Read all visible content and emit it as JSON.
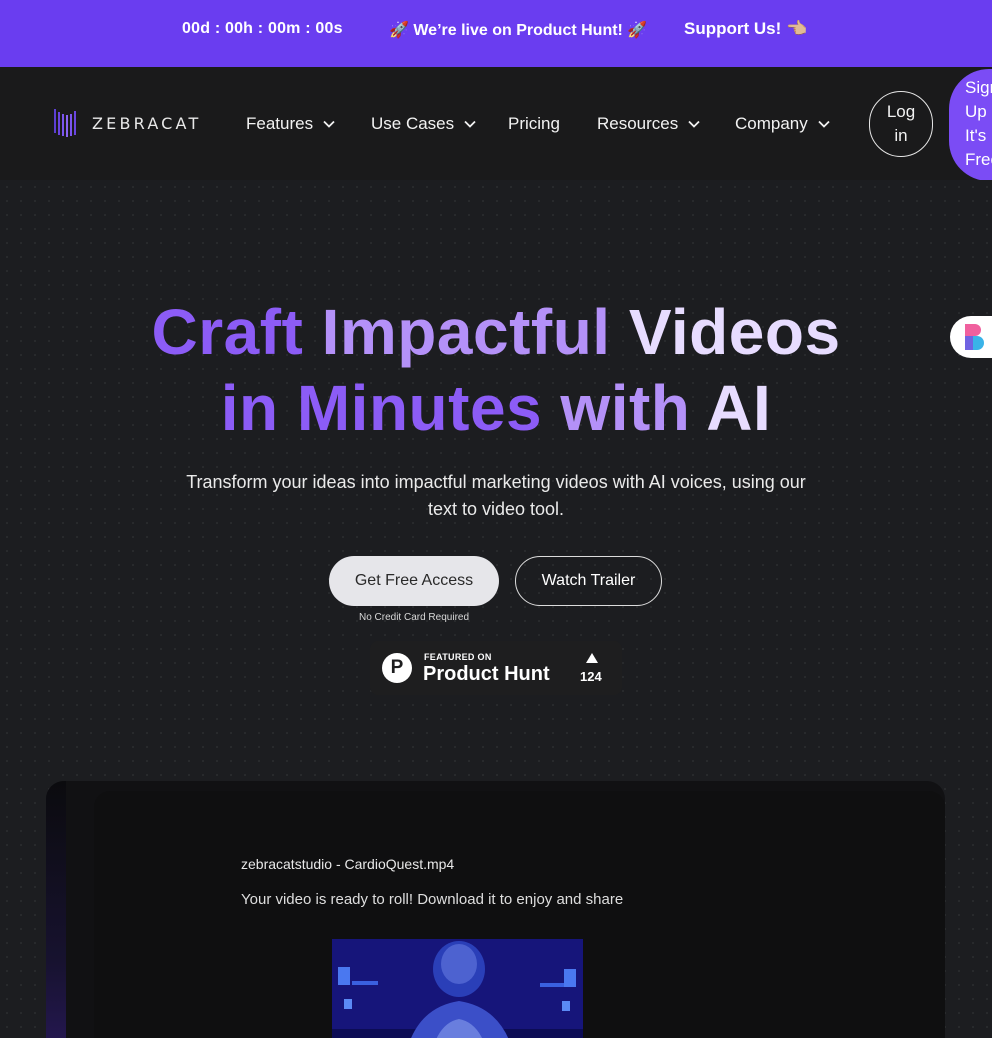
{
  "promo": {
    "timer": "00d : 00h : 00m : 00s",
    "live": "🚀 We’re live on Product Hunt! 🚀",
    "support": "Support Us! 👈🏼"
  },
  "nav": {
    "logo_text": "ZEBRACAT",
    "items": [
      {
        "label": "Features"
      },
      {
        "label": "Use Cases"
      },
      {
        "label": "Pricing"
      },
      {
        "label": "Resources"
      },
      {
        "label": "Company"
      }
    ],
    "login_line1": "Log",
    "login_line2": "in",
    "signup_lines": [
      "Sign",
      "Up",
      "It's",
      "Free"
    ]
  },
  "hero": {
    "headline_line1_a": "Craft ",
    "headline_line1_b": "Impactful ",
    "headline_line1_c": "Videos",
    "headline_line2_a": "in Minutes ",
    "headline_line2_b": "with ",
    "headline_line2_c": "AI",
    "subtitle": "Transform your ideas into impactful marketing videos with AI voices, using our text to video tool.",
    "cta_primary": "Get Free Access",
    "cta_secondary": "Watch Trailer",
    "no_credit_card": "No Credit Card Required"
  },
  "product_hunt": {
    "featured_label": "FEATURED ON",
    "name": "Product Hunt",
    "upvotes": "124",
    "letter": "P"
  },
  "video_preview": {
    "file_name": "zebracatstudio - CardioQuest.mp4",
    "message": "Your video is ready to roll! Download it to enjoy and share"
  },
  "colors": {
    "promo_bg": "#6a3df0",
    "accent": "#8c5cf6",
    "page_bg": "#1c1d20"
  }
}
